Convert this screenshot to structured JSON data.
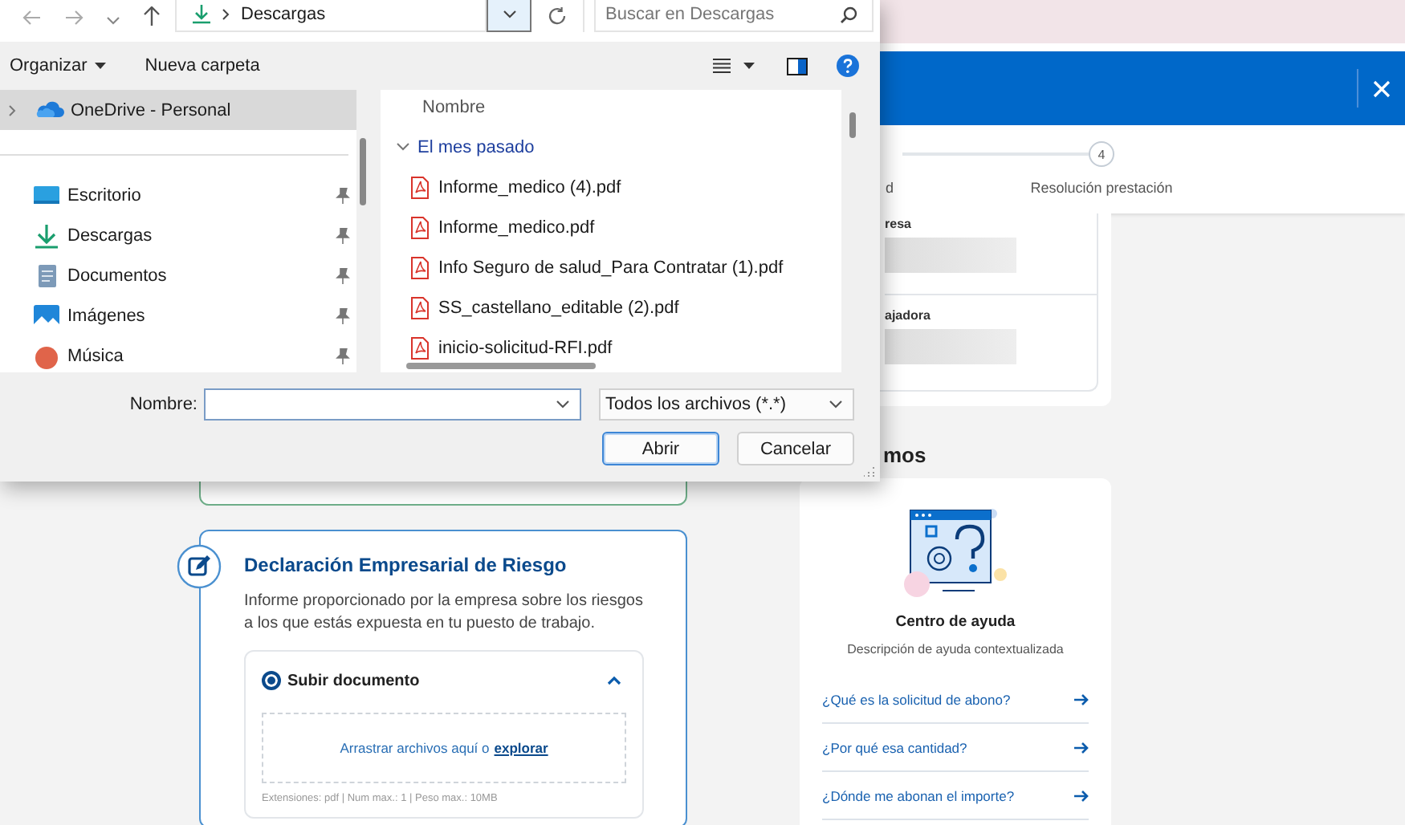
{
  "page": {
    "header": {
      "close": true
    },
    "stepper": {
      "steps": [
        {
          "label": "d"
        },
        {
          "number": "4",
          "label": "Resolución prestación"
        }
      ]
    },
    "info_card": {
      "fields": [
        {
          "label": "resa"
        },
        {
          "label": "ajadora"
        }
      ]
    },
    "section_heading": "mos",
    "declaration": {
      "title": "Declaración Empresarial de Riesgo",
      "description": "Informe proporcionado por la empresa sobre los riesgos a los que estás expuesta en tu puesto de trabajo.",
      "option": {
        "label": "Subir documento",
        "selected": true,
        "expanded": true
      },
      "drop_text": "Arrastrar archivos aquí o",
      "browse_link": "explorar",
      "hint": "Extensiones: pdf | Num max.: 1 | Peso max.: 10MB"
    },
    "help": {
      "title": "Centro de ayuda",
      "description": "Descripción de ayuda contextualizada",
      "links": [
        "¿Qué es la solicitud de abono?",
        "¿Por qué esa cantidad?",
        "¿Dónde me abonan el importe?"
      ]
    }
  },
  "file_dialog": {
    "address": {
      "path": "Descargas"
    },
    "search": {
      "placeholder": "Buscar en Descargas"
    },
    "toolbar": {
      "buttons": [
        "Organizar",
        "Nueva carpeta"
      ]
    },
    "nav_pane": {
      "items": [
        {
          "label": "OneDrive - Personal",
          "kind": "cloud",
          "selected": true,
          "pinned": false
        },
        {
          "label": "Escritorio",
          "kind": "desktop",
          "selected": false,
          "pinned": true
        },
        {
          "label": "Descargas",
          "kind": "download",
          "selected": false,
          "pinned": true
        },
        {
          "label": "Documentos",
          "kind": "documents",
          "selected": false,
          "pinned": true
        },
        {
          "label": "Imágenes",
          "kind": "pictures",
          "selected": false,
          "pinned": true
        },
        {
          "label": "Música",
          "kind": "music",
          "selected": false,
          "pinned": true
        }
      ]
    },
    "file_list": {
      "column": "Nombre",
      "groups": [
        {
          "label": "El mes pasado",
          "expanded": true,
          "files": [
            "Informe_medico (4).pdf",
            "Informe_medico.pdf",
            "Info Seguro de salud_Para Contratar (1).pdf",
            "SS_castellano_editable (2).pdf",
            "inicio-solicitud-RFI.pdf"
          ]
        }
      ]
    },
    "filename": {
      "label": "Nombre:"
    },
    "filter": "Todos los archivos (*.*)",
    "buttons": [
      {
        "label": "Abrir",
        "default": true
      },
      {
        "label": "Cancelar",
        "default": false
      }
    ]
  }
}
